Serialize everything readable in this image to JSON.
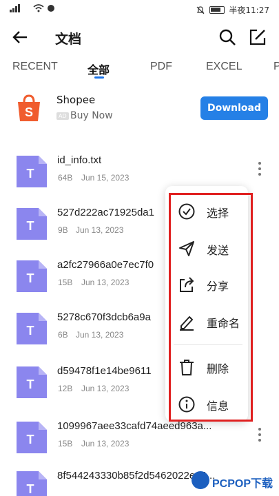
{
  "status_bar": {
    "time_text": "半夜11:27"
  },
  "header": {
    "title": "文档"
  },
  "tabs": [
    {
      "label": "RECENT"
    },
    {
      "label": "全部"
    },
    {
      "label": "PDF"
    },
    {
      "label": "EXCEL"
    },
    {
      "label": "P"
    }
  ],
  "ad": {
    "name": "Shopee",
    "badge": "AD",
    "subtitle": "Buy Now",
    "button_label": "Download",
    "brand_color": "#f05c2e",
    "button_color": "#2580e6"
  },
  "files": [
    {
      "name": "id_info.txt",
      "size": "64B",
      "date": "Jun 15, 2023"
    },
    {
      "name": "527d222ac71925da1",
      "size": "9B",
      "date": "Jun 13, 2023"
    },
    {
      "name": "a2fc27966a0e7ec7f0",
      "size": "15B",
      "date": "Jun 13, 2023"
    },
    {
      "name": "5278c670f3dcb6a9a",
      "size": "6B",
      "date": "Jun 13, 2023"
    },
    {
      "name": "d59478f1e14be9611",
      "size": "12B",
      "date": "Jun 13, 2023"
    },
    {
      "name": "1099967aee33cafd74aeed963a...",
      "size": "15B",
      "date": "Jun 13, 2023"
    },
    {
      "name": "8f544243330b85f2d5462022e14...",
      "size": "",
      "date": ""
    }
  ],
  "file_icon_letter": "T",
  "menu": {
    "items": [
      {
        "label": "选择",
        "icon": "check-circle-icon"
      },
      {
        "label": "发送",
        "icon": "send-icon"
      },
      {
        "label": "分享",
        "icon": "share-icon"
      },
      {
        "label": "重命名",
        "icon": "pen-icon"
      },
      {
        "label": "删除",
        "icon": "trash-icon"
      },
      {
        "label": "信息",
        "icon": "info-icon"
      }
    ],
    "highlight_color": "#e02020"
  },
  "watermark": {
    "text": "PCPOP下载"
  }
}
